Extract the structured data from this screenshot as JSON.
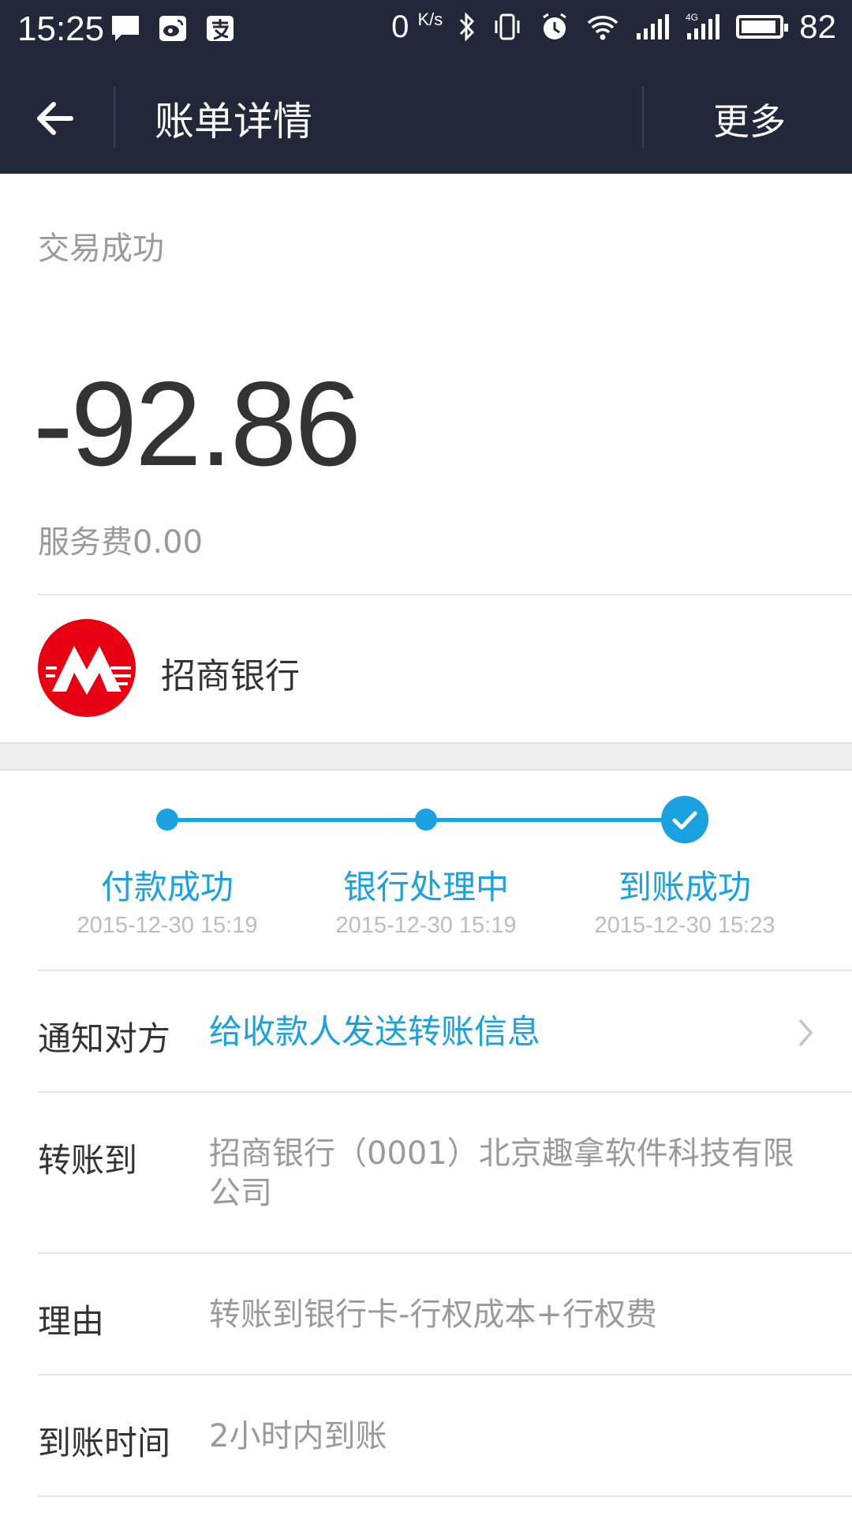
{
  "status_bar": {
    "time": "15:25",
    "net_speed": "0",
    "net_unit": "K/s",
    "battery": "82",
    "icons": [
      "message-icon",
      "weibo-icon",
      "alipay-icon",
      "bluetooth-icon",
      "vibrate-icon",
      "alarm-icon",
      "wifi-icon",
      "signal-icon",
      "signal-4g-icon",
      "battery-icon"
    ]
  },
  "nav": {
    "title": "账单详情",
    "more": "更多"
  },
  "summary": {
    "status": "交易成功",
    "amount": "-92.86",
    "fee": "服务费0.00",
    "bank_name": "招商银行"
  },
  "progress": {
    "steps": [
      {
        "label": "付款成功",
        "time": "2015-12-30 15:19"
      },
      {
        "label": "银行处理中",
        "time": "2015-12-30 15:19"
      },
      {
        "label": "到账成功",
        "time": "2015-12-30 15:23"
      }
    ],
    "colors": {
      "accent": "#1aa1e0"
    }
  },
  "details": {
    "notify_label": "通知对方",
    "notify_value": "给收款人发送转账信息",
    "to_label": "转账到",
    "to_value": "招商银行（0001）北京趣拿软件科技有限公司",
    "reason_label": "理由",
    "reason_value": "转账到银行卡-行权成本+行权费",
    "arrival_label": "到账时间",
    "arrival_value": "2小时内到账"
  },
  "colors": {
    "header_bg": "#22283a",
    "accent": "#1aa1e0",
    "logo_red": "#e60012"
  }
}
